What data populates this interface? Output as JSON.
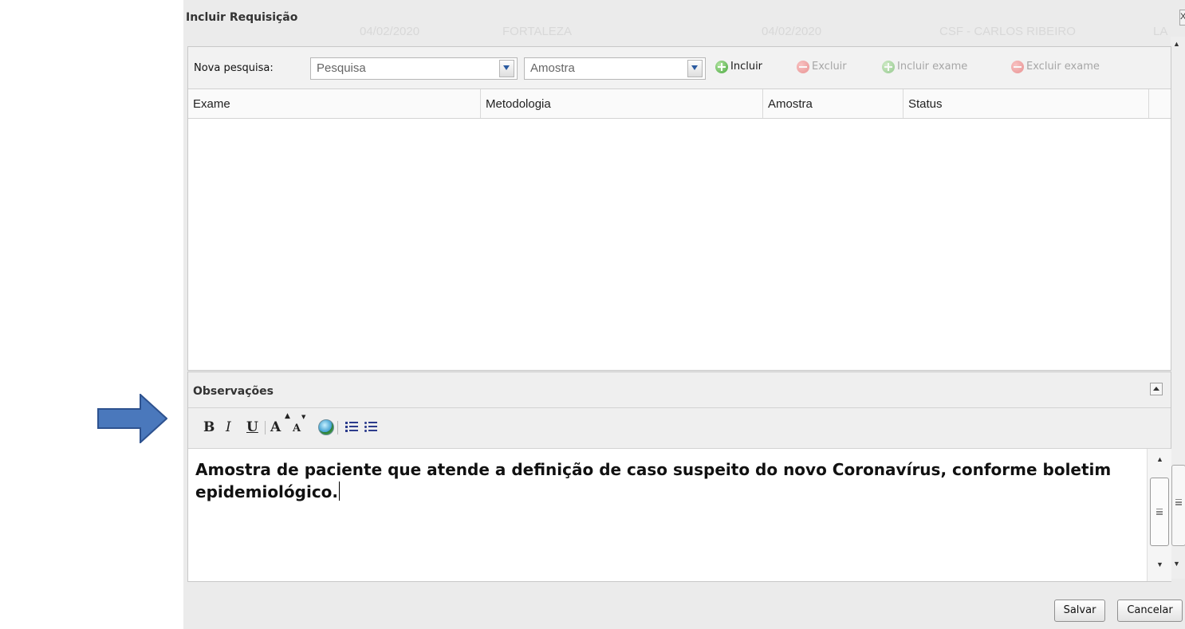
{
  "dialog": {
    "title": "Incluir Requisição",
    "background_row": [
      "04/02/2020",
      "FORTALEZA",
      "04/02/2020",
      "CSF - CARLOS RIBEIRO",
      "LA"
    ],
    "close_glyph": "X"
  },
  "toolbar": {
    "search_label": "Nova pesquisa:",
    "search_value": "Pesquisa",
    "sample_value": "Amostra",
    "add_label": "Incluir",
    "remove_label": "Excluir",
    "add_exam_label": "Incluir exame",
    "remove_exam_label": "Excluir exame"
  },
  "table": {
    "columns": [
      "Exame",
      "Metodologia",
      "Amostra",
      "Status"
    ],
    "rows": []
  },
  "observations": {
    "title": "Observações",
    "format_buttons": {
      "bold": "B",
      "italic": "I",
      "underline": "U",
      "grow_font": "A",
      "shrink_font": "A"
    },
    "text": "Amostra de paciente que atende a definição de caso suspeito do novo Coronavírus, conforme boletim epidemiológico."
  },
  "footer": {
    "save_label": "Salvar",
    "cancel_label": "Cancelar"
  },
  "colors": {
    "arrow": "#4a78bc",
    "arrow_border": "#2e528f",
    "add_icon": "#46a63a",
    "remove_icon": "#e04545"
  }
}
